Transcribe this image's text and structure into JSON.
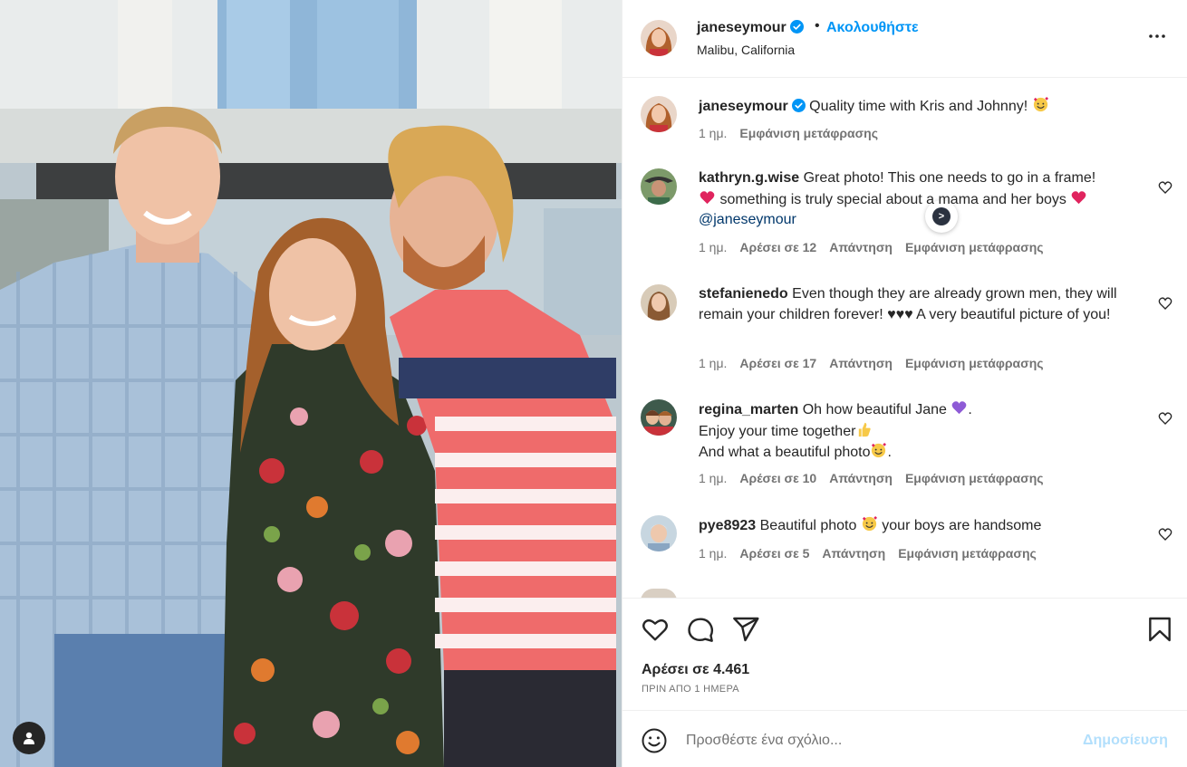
{
  "post": {
    "username": "janeseymour",
    "follow_label": "Ακολουθήστε",
    "dot": "•",
    "location": "Malibu, California"
  },
  "caption": {
    "username": "janeseymour",
    "text": "Quality time with Kris and Johnny!",
    "time": "1 ημ.",
    "translate": "Εμφάνιση μετάφρασης"
  },
  "comments": [
    {
      "username": "kathryn.g.wise",
      "text_parts": [
        "Great photo! This one needs to go in a frame!",
        "something is truly special about a mama and her boys",
        "@janeseymour"
      ],
      "time": "1 ημ.",
      "likes": "Αρέσει σε 12",
      "reply": "Απάντηση",
      "translate": "Εμφάνιση μετάφρασης"
    },
    {
      "username": "stefanienedo",
      "text_parts": [
        "Even though they are already grown men, they will remain your children forever!",
        "♥♥♥",
        "A very beautiful picture of you!"
      ],
      "time": "1 ημ.",
      "likes": "Αρέσει σε 17",
      "reply": "Απάντηση",
      "translate": "Εμφάνιση μετάφρασης"
    },
    {
      "username": "regina_marten",
      "text_parts": [
        "Oh how beautiful Jane",
        ".",
        "Enjoy your time together",
        "And what a beautiful photo",
        "."
      ],
      "time": "1 ημ.",
      "likes": "Αρέσει σε 10",
      "reply": "Απάντηση",
      "translate": "Εμφάνιση μετάφρασης"
    },
    {
      "username": "pye8923",
      "text_parts": [
        "Beautiful photo",
        "your boys are handsome"
      ],
      "time": "1 ημ.",
      "likes": "Αρέσει σε 5",
      "reply": "Απάντηση",
      "translate": "Εμφάνιση μετάφρασης"
    }
  ],
  "stats": {
    "likes": "Αρέσει σε 4.461",
    "time_ago": "ΠΡΙΝ ΑΠΟ 1 ΗΜΕΡΑ"
  },
  "add_comment": {
    "placeholder": "Προσθέστε ένα σχόλιο...",
    "post_label": "Δημοσίευση"
  },
  "colors": {
    "accent": "#0095f6",
    "post_disabled": "#b2dffc",
    "meta": "#737373",
    "text": "#262626"
  },
  "icons": [
    "verified-badge-icon",
    "more-options-icon",
    "heart-icon",
    "comment-icon",
    "share-icon",
    "bookmark-icon",
    "emoji-icon",
    "user-tag-icon",
    "translate-badge-icon"
  ]
}
